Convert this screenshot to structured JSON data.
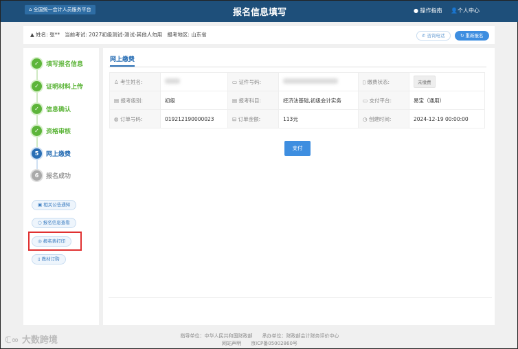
{
  "header": {
    "home": "全国统一会计人员服务平台",
    "title": "报名信息填写",
    "guide": "操作指南",
    "profile": "个人中心"
  },
  "infobar": {
    "name": "姓名: 张**",
    "exam": "当前考试: 2027初级测试-测试-其他人勿用",
    "region": "报考地区: 山东省",
    "consult": "咨询电话",
    "reapply": "重新报名"
  },
  "steps": [
    {
      "num": "1",
      "label": "填写报名信息",
      "state": "done"
    },
    {
      "num": "2",
      "label": "证明材料上传",
      "state": "done"
    },
    {
      "num": "3",
      "label": "信息确认",
      "state": "done"
    },
    {
      "num": "4",
      "label": "资格审核",
      "state": "done"
    },
    {
      "num": "5",
      "label": "网上缴费",
      "state": "current"
    },
    {
      "num": "6",
      "label": "报名成功",
      "state": "todo"
    }
  ],
  "side_buttons": [
    "相关公告通知",
    "报名信息查看",
    "报名表打印",
    "教材订购"
  ],
  "main": {
    "tab": "网上缴费",
    "pay": "支付",
    "fields": {
      "name_label": "考生姓名:",
      "id_label": "证件号码:",
      "status_label": "缴费状态:",
      "status": "未缴费",
      "level_label": "报考级别:",
      "level": "初级",
      "subject_label": "报考科目:",
      "subject": "经济法基础,初级会计实务",
      "platform_label": "支付平台:",
      "platform": "易宝（通用）",
      "order_label": "订单号码:",
      "order": "019212190000023",
      "amount_label": "订单金额:",
      "amount": "113元",
      "created_label": "创建时间:",
      "created": "2024-12-19 00:00:00"
    }
  },
  "footer": {
    "line1": "指导单位：中华人民共和国财政部　　承办单位：财政部会计财务评价中心",
    "statement": "网站声明",
    "icp": "京ICP备05002860号"
  },
  "watermark": "大数跨境"
}
